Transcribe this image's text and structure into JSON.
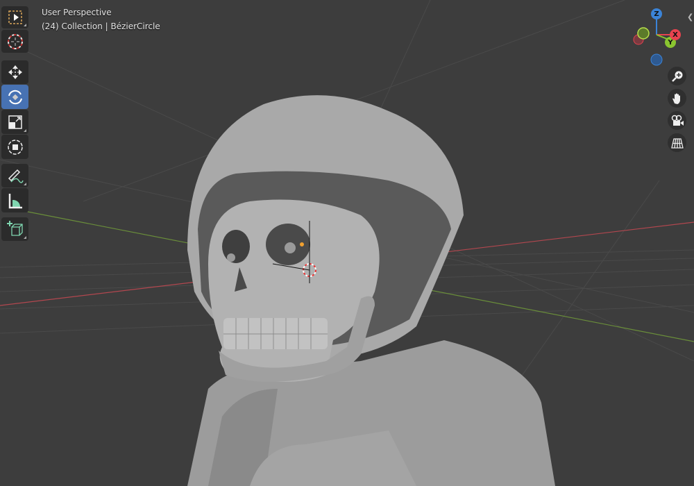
{
  "viewport": {
    "view_name": "User Perspective",
    "context": "(24) Collection | BézierCircle"
  },
  "toolbar": {
    "tools": [
      {
        "name": "select-box",
        "active": false
      },
      {
        "name": "cursor",
        "active": false
      },
      {
        "name": "move",
        "active": false
      },
      {
        "name": "rotate",
        "active": true
      },
      {
        "name": "scale",
        "active": false
      },
      {
        "name": "transform",
        "active": false
      },
      {
        "name": "annotate",
        "active": false
      },
      {
        "name": "measure",
        "active": false
      },
      {
        "name": "add-cube",
        "active": false
      }
    ]
  },
  "gizmo": {
    "x_label": "X",
    "y_label": "Y",
    "z_label": "Z",
    "colors": {
      "x": "#e8434f",
      "y": "#8ac530",
      "z": "#3b84d8"
    }
  },
  "nav_buttons": [
    "zoom-icon",
    "hand-icon",
    "camera-icon",
    "grid-icon"
  ],
  "colors": {
    "background": "#3d3d3d",
    "active_tool": "#4772b3",
    "mesh": "#a8a8a8"
  }
}
